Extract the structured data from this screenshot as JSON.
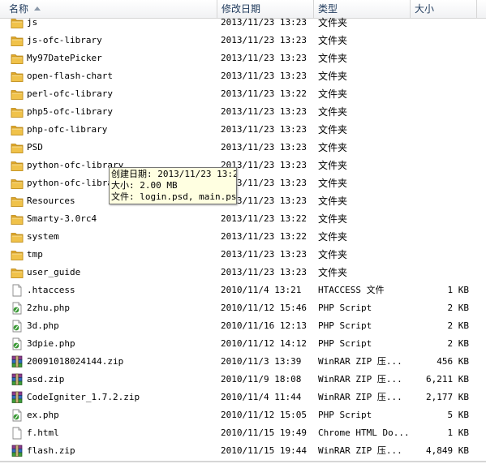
{
  "header": {
    "name": "名称",
    "date_modified": "修改日期",
    "type": "类型",
    "size": "大小"
  },
  "files": [
    {
      "name": "js",
      "date": "2013/11/23 13:23",
      "type": "文件夹",
      "size": "",
      "icon": "folder-icon"
    },
    {
      "name": "js-ofc-library",
      "date": "2013/11/23 13:23",
      "type": "文件夹",
      "size": "",
      "icon": "folder-icon"
    },
    {
      "name": "My97DatePicker",
      "date": "2013/11/23 13:23",
      "type": "文件夹",
      "size": "",
      "icon": "folder-icon"
    },
    {
      "name": "open-flash-chart",
      "date": "2013/11/23 13:23",
      "type": "文件夹",
      "size": "",
      "icon": "folder-icon"
    },
    {
      "name": "perl-ofc-library",
      "date": "2013/11/23 13:22",
      "type": "文件夹",
      "size": "",
      "icon": "folder-icon"
    },
    {
      "name": "php5-ofc-library",
      "date": "2013/11/23 13:23",
      "type": "文件夹",
      "size": "",
      "icon": "folder-icon"
    },
    {
      "name": "php-ofc-library",
      "date": "2013/11/23 13:23",
      "type": "文件夹",
      "size": "",
      "icon": "folder-icon"
    },
    {
      "name": "PSD",
      "date": "2013/11/23 13:23",
      "type": "文件夹",
      "size": "",
      "icon": "folder-icon"
    },
    {
      "name": "python-ofc-library",
      "date": "2013/11/23 13:23",
      "type": "文件夹",
      "size": "",
      "icon": "folder-icon"
    },
    {
      "name": "python-ofc-library",
      "date": "2013/11/23 13:23",
      "type": "文件夹",
      "size": "",
      "icon": "folder-icon"
    },
    {
      "name": "Resources",
      "date": "2013/11/23 13:23",
      "type": "文件夹",
      "size": "",
      "icon": "folder-icon"
    },
    {
      "name": "Smarty-3.0rc4",
      "date": "2013/11/23 13:22",
      "type": "文件夹",
      "size": "",
      "icon": "folder-icon"
    },
    {
      "name": "system",
      "date": "2013/11/23 13:22",
      "type": "文件夹",
      "size": "",
      "icon": "folder-icon"
    },
    {
      "name": "tmp",
      "date": "2013/11/23 13:23",
      "type": "文件夹",
      "size": "",
      "icon": "folder-icon"
    },
    {
      "name": "user_guide",
      "date": "2013/11/23 13:23",
      "type": "文件夹",
      "size": "",
      "icon": "folder-icon"
    },
    {
      "name": ".htaccess",
      "date": "2010/11/4 13:21",
      "type": "HTACCESS 文件",
      "size": "1 KB",
      "icon": "blank-file-icon"
    },
    {
      "name": "2zhu.php",
      "date": "2010/11/12 15:46",
      "type": "PHP Script",
      "size": "2 KB",
      "icon": "php-script-icon"
    },
    {
      "name": "3d.php",
      "date": "2010/11/16 12:13",
      "type": "PHP Script",
      "size": "2 KB",
      "icon": "php-script-icon"
    },
    {
      "name": "3dpie.php",
      "date": "2010/11/12 14:12",
      "type": "PHP Script",
      "size": "2 KB",
      "icon": "php-script-icon"
    },
    {
      "name": "20091018024144.zip",
      "date": "2010/11/3 13:39",
      "type": "WinRAR ZIP 压...",
      "size": "456 KB",
      "icon": "winrar-zip-icon"
    },
    {
      "name": "asd.zip",
      "date": "2010/11/9 18:08",
      "type": "WinRAR ZIP 压...",
      "size": "6,211 KB",
      "icon": "winrar-zip-icon"
    },
    {
      "name": "CodeIgniter_1.7.2.zip",
      "date": "2010/11/4 11:44",
      "type": "WinRAR ZIP 压...",
      "size": "2,177 KB",
      "icon": "winrar-zip-icon"
    },
    {
      "name": "ex.php",
      "date": "2010/11/12 15:05",
      "type": "PHP Script",
      "size": "5 KB",
      "icon": "php-script-icon"
    },
    {
      "name": "f.html",
      "date": "2010/11/15 19:49",
      "type": "Chrome HTML Do...",
      "size": "1 KB",
      "icon": "blank-file-icon"
    },
    {
      "name": "flash.zip",
      "date": "2010/11/15 19:44",
      "type": "WinRAR ZIP 压...",
      "size": "4,849 KB",
      "icon": "winrar-zip-icon"
    }
  ],
  "tooltip": {
    "created": "创建日期: 2013/11/23 13:23",
    "size": "大小: 2.00 MB",
    "files": "文件: login.psd, main.psd"
  },
  "colors": {
    "folder": "#f0c24a",
    "php": "#3a9a35",
    "winrar": "#8a3a8c",
    "tooltip_bg": "#ffffe1",
    "header_text": "#1e395b"
  }
}
